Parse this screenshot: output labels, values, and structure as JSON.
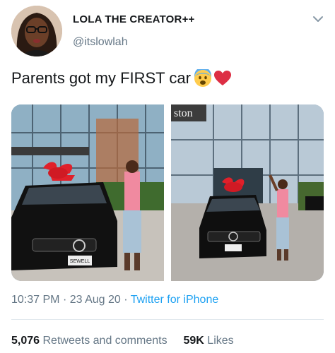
{
  "user": {
    "display_name": "LOLA THE CREATOR++",
    "handle": "@itslowlah"
  },
  "tweet": {
    "text": "Parents got my FIRST car",
    "emojis": [
      "fearful-face-emoji",
      "red-heart-emoji"
    ]
  },
  "media": {
    "left_photo": "car-with-bow-photo-1",
    "right_photo": "car-with-bow-photo-2",
    "sign_text": "ston",
    "plate_text": "SEWELL"
  },
  "meta": {
    "time": "10:37 PM",
    "separator": "·",
    "date": "23 Aug 20",
    "source": "Twitter for iPhone"
  },
  "stats": {
    "retweets_count": "5,076",
    "retweets_label": "Retweets and comments",
    "likes_count": "59K",
    "likes_label": "Likes"
  },
  "colors": {
    "link": "#1da1f2",
    "secondary_text": "#657786",
    "primary_text": "#14171a"
  }
}
